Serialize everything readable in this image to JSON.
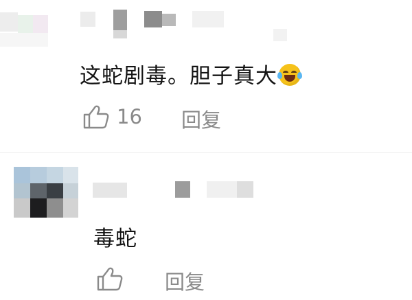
{
  "comments": [
    {
      "text": "这蛇剧毒。胆子真大",
      "emoji_icon": "rolling-on-the-floor-laughing-emoji",
      "like_icon": "thumbs-up-icon",
      "like_count": "16",
      "reply_label": "回复"
    },
    {
      "text": "毒蛇",
      "like_icon": "thumbs-up-icon",
      "reply_label": "回复"
    }
  ],
  "colors": {
    "text": "#141414",
    "meta": "#8a8a8a",
    "emoji": "#f6c21a",
    "divider": "#f0f0f0"
  }
}
